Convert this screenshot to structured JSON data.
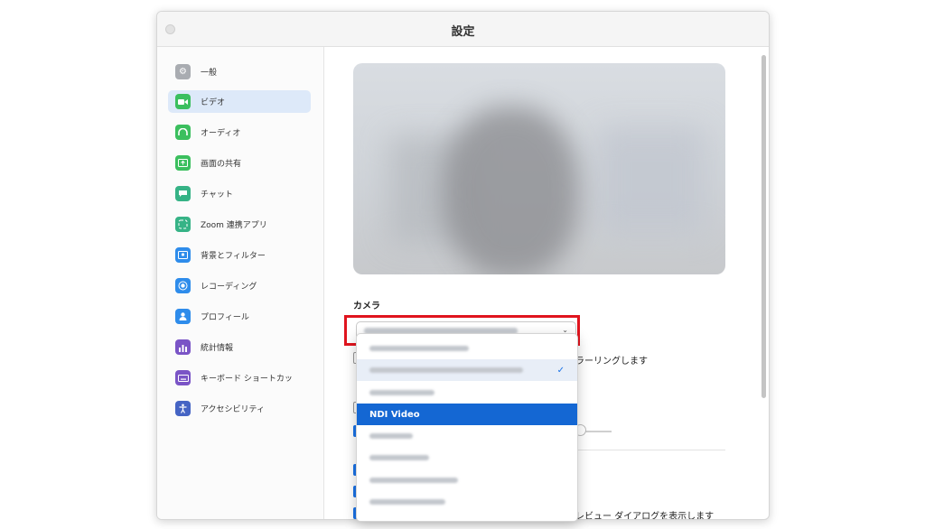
{
  "window": {
    "title": "設定"
  },
  "sidebar": {
    "items": [
      {
        "label": "一般",
        "icon": "gear-icon",
        "color": "#a9acb1",
        "active": false
      },
      {
        "label": "ビデオ",
        "icon": "video-icon",
        "color": "#3bbf5e",
        "active": true
      },
      {
        "label": "オーディオ",
        "icon": "headphones-icon",
        "color": "#3bbf5e",
        "active": false
      },
      {
        "label": "画面の共有",
        "icon": "share-screen-icon",
        "color": "#3bbf5e",
        "active": false
      },
      {
        "label": "チャット",
        "icon": "chat-icon",
        "color": "#36b386",
        "active": false
      },
      {
        "label": "Zoom 連携アプリ",
        "icon": "apps-icon",
        "color": "#36b386",
        "active": false
      },
      {
        "label": "背景とフィルター",
        "icon": "background-icon",
        "color": "#2e8ceb",
        "active": false
      },
      {
        "label": "レコーディング",
        "icon": "record-icon",
        "color": "#2e8ceb",
        "active": false
      },
      {
        "label": "プロフィール",
        "icon": "profile-icon",
        "color": "#2e8ceb",
        "active": false
      },
      {
        "label": "統計情報",
        "icon": "stats-icon",
        "color": "#7a54c6",
        "active": false
      },
      {
        "label": "キーボード ショートカッ",
        "icon": "keyboard-icon",
        "color": "#7a54c6",
        "active": false
      },
      {
        "label": "アクセシビリティ",
        "icon": "accessibility-icon",
        "color": "#4564c4",
        "active": false
      }
    ]
  },
  "video": {
    "camera_label": "カメラ",
    "mirroring_text": "ミラーリングします",
    "preview_dialog_text": "プレビュー ダイアログを表示します"
  },
  "dropdown": {
    "options": [
      {
        "label": "",
        "state": "normal"
      },
      {
        "label": "",
        "state": "selected"
      },
      {
        "label": "",
        "state": "normal"
      },
      {
        "label": "NDI Video",
        "state": "hover"
      },
      {
        "label": "",
        "state": "normal"
      },
      {
        "label": "",
        "state": "normal"
      },
      {
        "label": "",
        "state": "normal"
      },
      {
        "label": "",
        "state": "normal"
      }
    ],
    "check_glyph": "✓"
  },
  "colors": {
    "accent": "#1467d3",
    "highlight_box": "#e0141e"
  }
}
